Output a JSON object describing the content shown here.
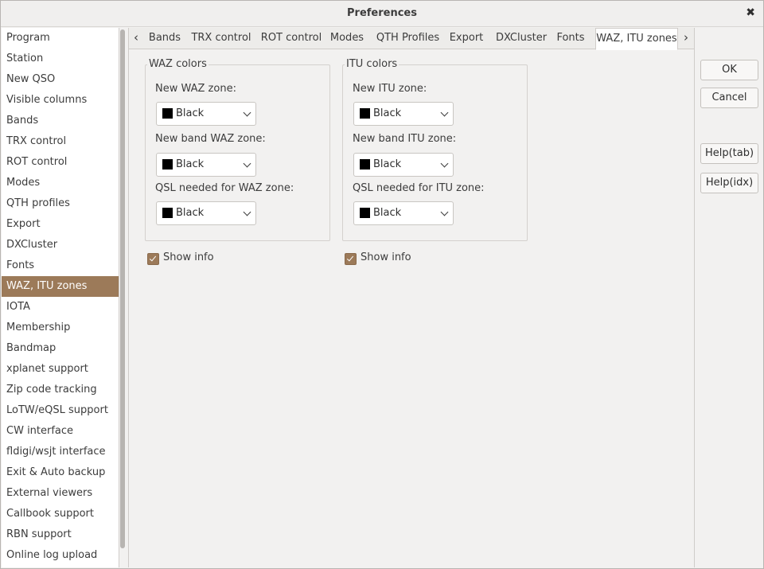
{
  "window": {
    "title": "Preferences"
  },
  "sidebar": {
    "items": [
      {
        "label": "Program"
      },
      {
        "label": "Station"
      },
      {
        "label": "New QSO"
      },
      {
        "label": "Visible columns"
      },
      {
        "label": "Bands"
      },
      {
        "label": "TRX control"
      },
      {
        "label": "ROT control"
      },
      {
        "label": "Modes"
      },
      {
        "label": "QTH profiles"
      },
      {
        "label": "Export"
      },
      {
        "label": "DXCluster"
      },
      {
        "label": "Fonts"
      },
      {
        "label": "WAZ, ITU zones",
        "selected": true
      },
      {
        "label": "IOTA"
      },
      {
        "label": "Membership"
      },
      {
        "label": "Bandmap"
      },
      {
        "label": "xplanet support"
      },
      {
        "label": "Zip code tracking"
      },
      {
        "label": "LoTW/eQSL support"
      },
      {
        "label": "CW interface"
      },
      {
        "label": "fldigi/wsjt interface"
      },
      {
        "label": "Exit & Auto backup"
      },
      {
        "label": "External viewers"
      },
      {
        "label": "Callbook support"
      },
      {
        "label": "RBN support"
      },
      {
        "label": "Online log upload"
      }
    ]
  },
  "tabs": {
    "items": [
      "Bands",
      "TRX control",
      "ROT control",
      "Modes",
      "QTH Profiles",
      "Export",
      "DXCluster",
      "Fonts",
      "WAZ, ITU zones"
    ],
    "active": "WAZ, ITU zones"
  },
  "waz": {
    "title": "WAZ colors",
    "new_zone_label": "New WAZ zone:",
    "new_zone_value": "Black",
    "new_band_label": "New band WAZ zone:",
    "new_band_value": "Black",
    "qsl_label": "QSL needed for WAZ zone:",
    "qsl_value": "Black",
    "show_info_label": "Show info",
    "show_info_checked": true
  },
  "itu": {
    "title": "ITU colors",
    "new_zone_label": "New ITU zone:",
    "new_zone_value": "Black",
    "new_band_label": "New band ITU zone:",
    "new_band_value": "Black",
    "qsl_label": "QSL needed for ITU zone:",
    "qsl_value": "Black",
    "show_info_label": "Show info",
    "show_info_checked": true
  },
  "buttons": {
    "ok": "OK",
    "cancel": "Cancel",
    "help_tab": "Help(tab)",
    "help_idx": "Help(idx)"
  },
  "colors": {
    "accent": "#9c7a59",
    "swatch": "#000000"
  }
}
